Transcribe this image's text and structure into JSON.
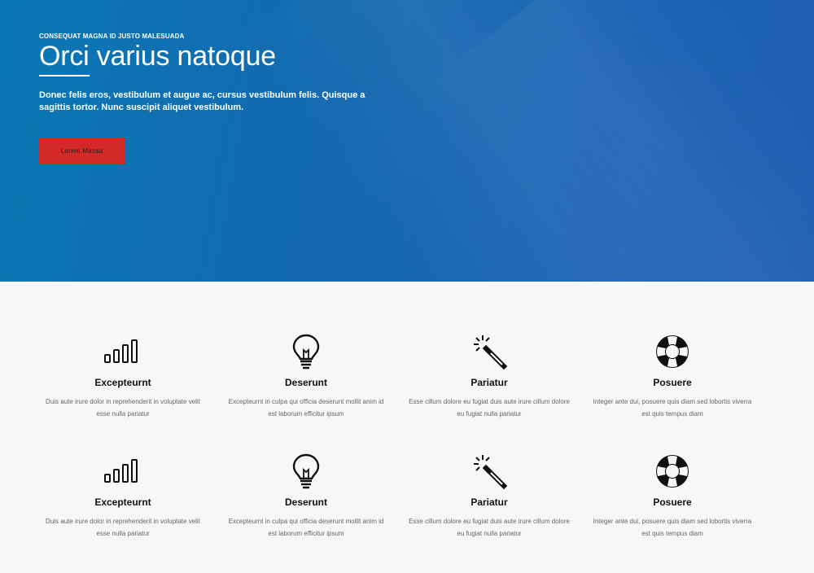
{
  "hero": {
    "eyebrow": "CONSEQUAT MAGNA ID JUSTO MALESUADA",
    "title": "Orci varius natoque",
    "description": "Donec felis eros, vestibulum et augue ac, cursus vestibulum felis. Quisque a sagittis tortor. Nunc suscipit aliquet vestibulum.",
    "cta_label": "Lorem Massa"
  },
  "colors": {
    "hero_bg": "#1469b0",
    "cta_bg": "#d42a27",
    "section_bg": "#f7f7f7"
  },
  "features": [
    {
      "icon": "signal-bars-icon",
      "title": "Excepteurnt",
      "desc": "Duis aute irure dolor in reprehenderit in voluptate velit esse nulla pariatur"
    },
    {
      "icon": "lightbulb-icon",
      "title": "Deserunt",
      "desc": "Excepteurnt in culpa qui officia deserunt mollit anim id est laborum efficitur ipsum"
    },
    {
      "icon": "magic-wand-icon",
      "title": "Pariatur",
      "desc": "Esse cillum dolore eu fugiat duis aute irure cillum dolore eu fugiat nulla pariatur"
    },
    {
      "icon": "lifebuoy-icon",
      "title": "Posuere",
      "desc": "Integer ante dui, posuere quis diam sed lobortis viverra est quis tempus diam"
    },
    {
      "icon": "signal-bars-icon",
      "title": "Excepteurnt",
      "desc": "Duis aute irure dolor in reprehenderit in voluptate velit esse nulla pariatur"
    },
    {
      "icon": "lightbulb-icon",
      "title": "Deserunt",
      "desc": "Excepteurnt in culpa qui officia deserunt mollit anim id est laborum efficitur ipsum"
    },
    {
      "icon": "magic-wand-icon",
      "title": "Pariatur",
      "desc": "Esse cillum dolore eu fugiat duis aute irure cillum dolore eu fugiat nulla pariatur"
    },
    {
      "icon": "lifebuoy-icon",
      "title": "Posuere",
      "desc": "Integer ante dui, posuere quis diam sed lobortis viverra est quis tempus diam"
    }
  ]
}
